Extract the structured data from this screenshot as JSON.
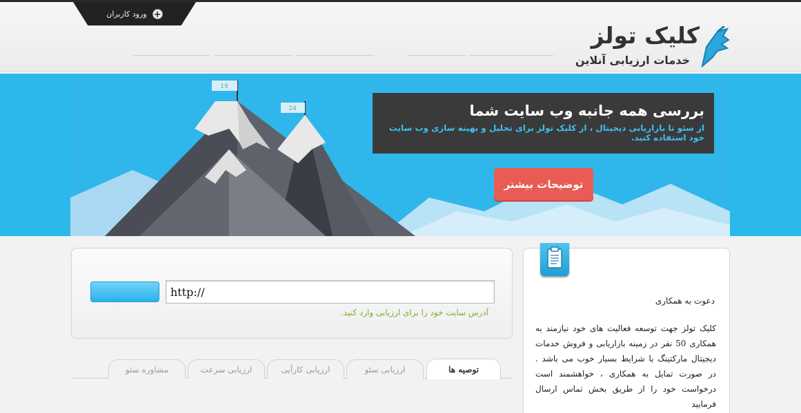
{
  "header": {
    "login_label": "ورود کاربران",
    "logo_name": "کلیک تولز",
    "logo_tagline": "خدمات ارزیابی آنلاین"
  },
  "banner": {
    "headline": "بررسی همه جانبه وب سایت شما",
    "subline": "از سئو تا بازاریابی دیجیتال ، از کلیک تولز برای تحلیل و بهینه سازی وب سایت خود استفاده کنید.",
    "more_button": "توضیحات بیشتر",
    "flag_left": "19",
    "flag_right": "24"
  },
  "search": {
    "url_value": "http://",
    "hint": "آدرس سایت خود را برای ارزیابی وارد کنید."
  },
  "tabs": [
    {
      "label": "توصیه ها",
      "active": true
    },
    {
      "label": "ارزیابی سئو",
      "active": false
    },
    {
      "label": "ارزیابی کارآیی",
      "active": false
    },
    {
      "label": "ارزیابی سرعت",
      "active": false
    },
    {
      "label": "مشاوره سئو",
      "active": false
    }
  ],
  "sidebar": {
    "title": "دعوت به همکاری",
    "text": "کلیک تولز جهت توسعه فعالیت های خود نیازمند به همکاری 50 نفر در زمینه بازاریابی و فروش خدمات دیجیتال مارکتینگ با شرایط بسیار خوب می باشد . در صورت تمایل به همکاری ، خواهشمند است درخواست خود را از طریق بخش تماس ارسال فرمایید"
  },
  "colors": {
    "banner_blue": "#2fb6ea",
    "button_red": "#e85c55",
    "hint_green": "#7ab02a",
    "promo_dark": "#3a3a3a"
  }
}
